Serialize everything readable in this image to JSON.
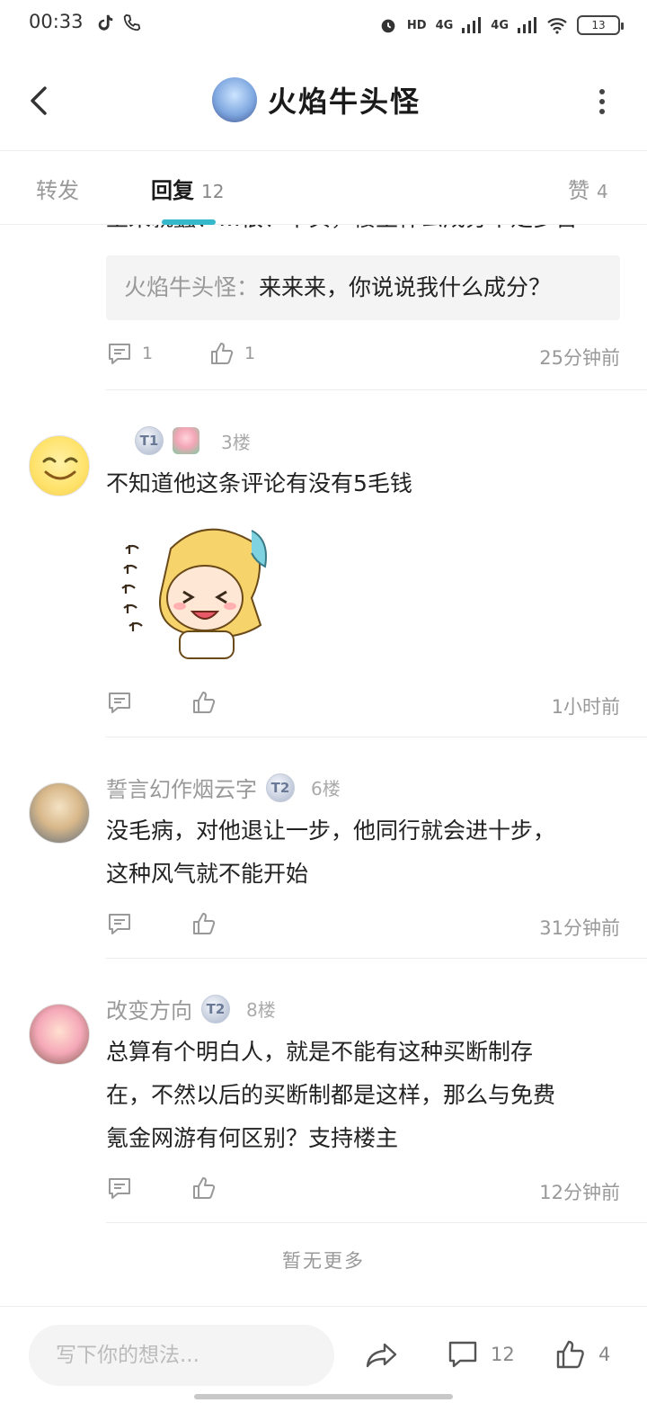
{
  "status_bar": {
    "time": "00:33",
    "network1": "4G",
    "network2": "4G",
    "battery": "13"
  },
  "header": {
    "title": "火焰牛头怪"
  },
  "tabs": [
    {
      "label": "转发",
      "count": ""
    },
    {
      "label": "回复",
      "count": "12"
    },
    {
      "label": "赞",
      "count": "4"
    }
  ],
  "accent_color": "#35b8c9",
  "top_reply": {
    "clipped_text": "至来就蠢、…很、十实，楼主什么成分不足多吾",
    "quote_name": "火焰牛头怪：",
    "quote_text": "来来来，你说说我什么成分？",
    "reply_count": "1",
    "like_count": "1",
    "time": "25分钟前"
  },
  "comments": [
    {
      "floor": "3楼",
      "badge": "T1",
      "name": "",
      "text": "不知道他这条评论有没有5毛钱",
      "time": "1小时前",
      "has_sticker": true
    },
    {
      "floor": "6楼",
      "badge": "T2",
      "name": "誓言幻作烟云字",
      "text_line1": "没毛病，对他退让一步，他同行就会进十步，",
      "text_line2": "这种风气就不能开始",
      "time": "31分钟前"
    },
    {
      "floor": "8楼",
      "badge": "T2",
      "name": "改变方向",
      "text_line1": "总算有个明白人，就是不能有这种买断制存",
      "text_line2": "在，不然以后的买断制都是这样，那么与免费",
      "text_line3": "氪金网游有何区别？支持楼主",
      "time": "12分钟前"
    }
  ],
  "no_more": "暂无更多",
  "bottom_bar": {
    "input_placeholder": "写下你的想法...",
    "comment_count": "12",
    "like_count": "4"
  }
}
